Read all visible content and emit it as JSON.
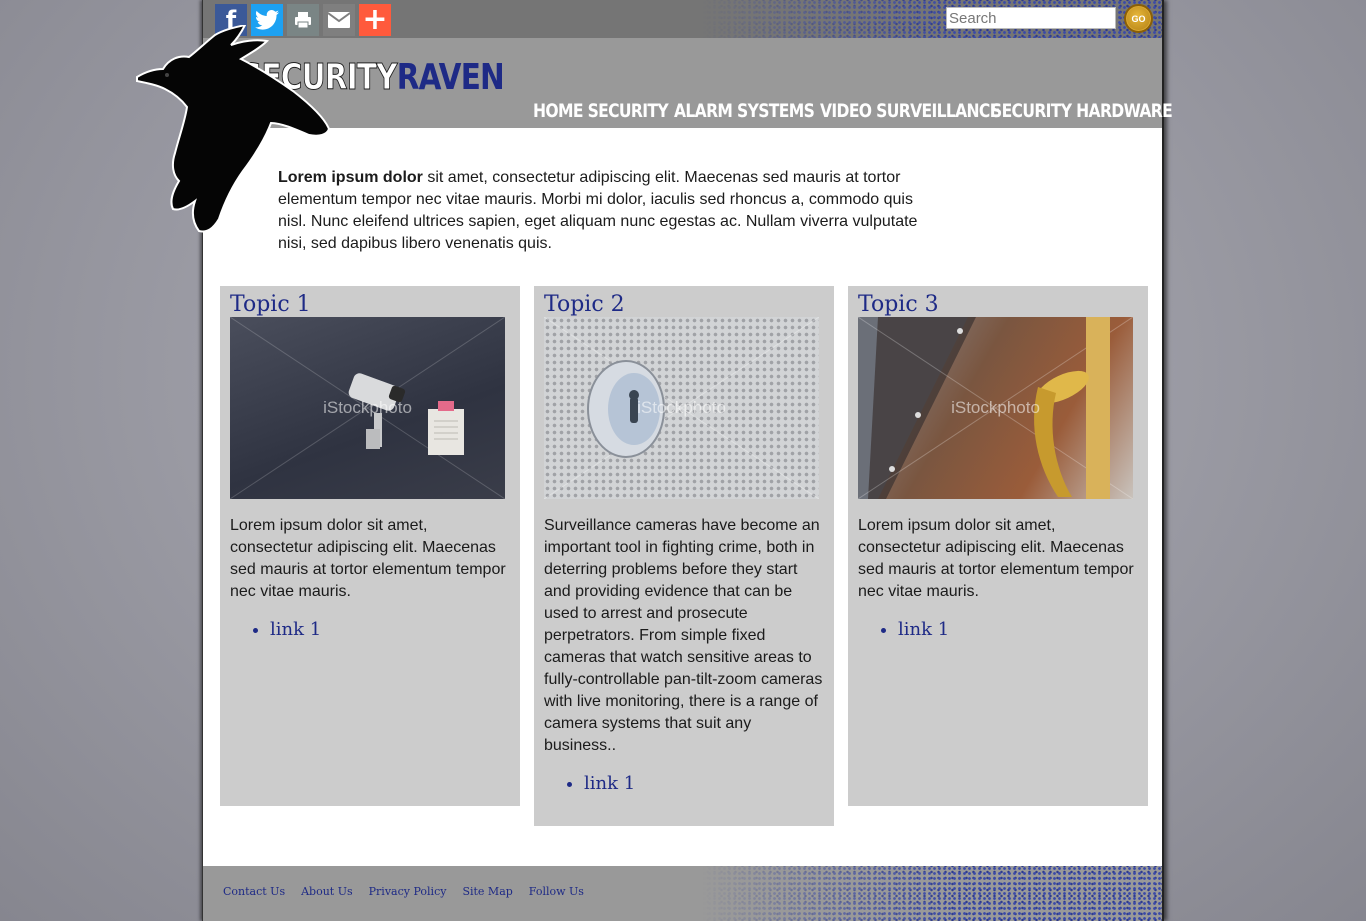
{
  "brand": {
    "logo_word1": "SECURITY",
    "logo_word2": "RAVEN",
    "accent_color": "#1e2a86"
  },
  "share_bar": {
    "icons": [
      "facebook-icon",
      "twitter-icon",
      "print-icon",
      "email-icon",
      "plus-icon"
    ],
    "search_placeholder": "Search",
    "go_label": "GO"
  },
  "nav": {
    "items": [
      "HOME SECURITY",
      "ALARM SYSTEMS",
      "VIDEO SURVEILLANCE",
      "SECURITY HARDWARE"
    ]
  },
  "intro": {
    "bold": "Lorem ipsum dolor",
    "text": " sit amet, consectetur adipiscing elit. Maecenas sed mauris at tortor elementum tempor nec vitae mauris. Morbi mi dolor, iaculis sed rhoncus a, commodo quis nisl. Nunc eleifend ultrices sapien, eget aliquam nunc egestas ac. Nullam viverra vulputate nisi, sed dapibus libero venenatis quis."
  },
  "topics": [
    {
      "title": "Topic 1",
      "image": "security-camera-photo",
      "watermark": "iStockphoto",
      "text": "Lorem ipsum dolor sit amet, consectetur adipiscing elit. Maecenas sed mauris at tortor elementum tempor nec vitae mauris.",
      "link": "link 1"
    },
    {
      "title": "Topic 2",
      "image": "lock-cylinder-photo",
      "watermark": "iStockphoto",
      "text": "Surveillance cameras have become an important tool in fighting crime, both in deterring problems before they start and providing evidence that can be used to arrest and prosecute perpetrators. From simple fixed cameras that watch sensitive areas to fully-controllable pan-tilt-zoom cameras with live monitoring, there is a range of camera systems that suit any business..",
      "link": "link 1"
    },
    {
      "title": "Topic 3",
      "image": "door-handle-photo",
      "watermark": "iStockphoto",
      "text": "Lorem ipsum dolor sit amet, consectetur adipiscing elit. Maecenas sed mauris at tortor elementum tempor nec vitae mauris.",
      "link": "link 1"
    }
  ],
  "footer": {
    "links": [
      "Contact Us",
      "About Us",
      "Privacy Policy",
      "Site Map",
      "Follow Us"
    ]
  }
}
